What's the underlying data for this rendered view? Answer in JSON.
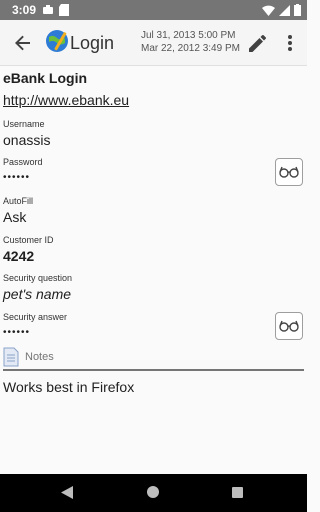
{
  "status_bar": {
    "time": "3:09"
  },
  "toolbar": {
    "title": "Login",
    "modified_date": "Jul 31, 2013 5:00 PM",
    "created_date": "Mar 22, 2012 3:49 PM"
  },
  "record": {
    "name": "eBank Login",
    "url": "http://www.ebank.eu",
    "fields": {
      "username_label": "Username",
      "username_value": "onassis",
      "password_label": "Password",
      "password_value": "••••••",
      "autofill_label": "AutoFill",
      "autofill_value": "Ask",
      "customer_id_label": "Customer ID",
      "customer_id_value": "4242",
      "security_question_label": "Security question",
      "security_question_value": "pet's name",
      "security_answer_label": "Security answer",
      "security_answer_value": "••••••"
    },
    "notes_label": "Notes",
    "notes_text": "Works best in Firefox"
  },
  "colors": {
    "status_bar": "#757575",
    "toolbar": "#f5f5f5",
    "nav_bar": "#000000"
  }
}
